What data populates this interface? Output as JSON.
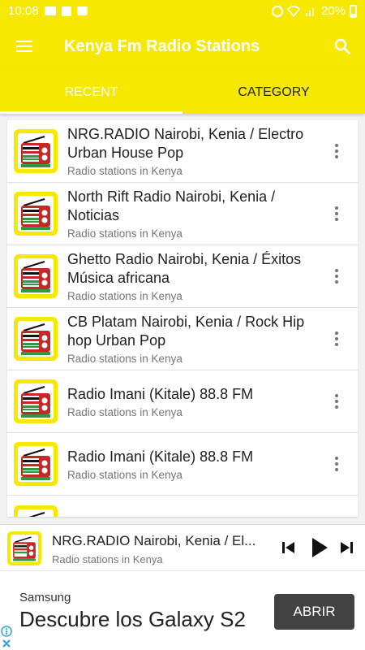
{
  "status_bar": {
    "time": "10:08",
    "battery": "20%"
  },
  "app_bar": {
    "title": "Kenya Fm Radio Stations",
    "menu_icon": "hamburger-menu-icon",
    "search_icon": "search-icon"
  },
  "tabs": [
    {
      "label": "RECENT",
      "active": true
    },
    {
      "label": "CATEGORY",
      "active": false
    }
  ],
  "stations": [
    {
      "title": "NRG.RADIO Nairobi, Kenia / Electro Urban House Pop",
      "subtitle": "Radio stations in Kenya"
    },
    {
      "title": "North Rift Radio Nairobi, Kenia / Noticias",
      "subtitle": "Radio stations in Kenya"
    },
    {
      "title": "Ghetto Radio Nairobi, Kenia / Éxitos Música africana",
      "subtitle": "Radio stations in Kenya"
    },
    {
      "title": "CB Platam Nairobi, Kenia / Rock Hip hop Urban Pop",
      "subtitle": "Radio stations in Kenya"
    },
    {
      "title": "Radio Imani (Kitale) 88.8 FM",
      "subtitle": "Radio stations in Kenya"
    },
    {
      "title": "Radio Imani (Kitale) 88.8 FM",
      "subtitle": "Radio stations in Kenya"
    }
  ],
  "player": {
    "title": "NRG.RADIO Nairobi, Kenia / El...",
    "subtitle": "Radio stations in Kenya"
  },
  "ad": {
    "brand": "Samsung",
    "headline": "Descubre los Galaxy S2",
    "cta": "ABRIR"
  },
  "colors": {
    "accent": "#f6e800",
    "flag_red": "#c62828",
    "flag_green": "#2e9a3e",
    "flag_black": "#111111"
  }
}
